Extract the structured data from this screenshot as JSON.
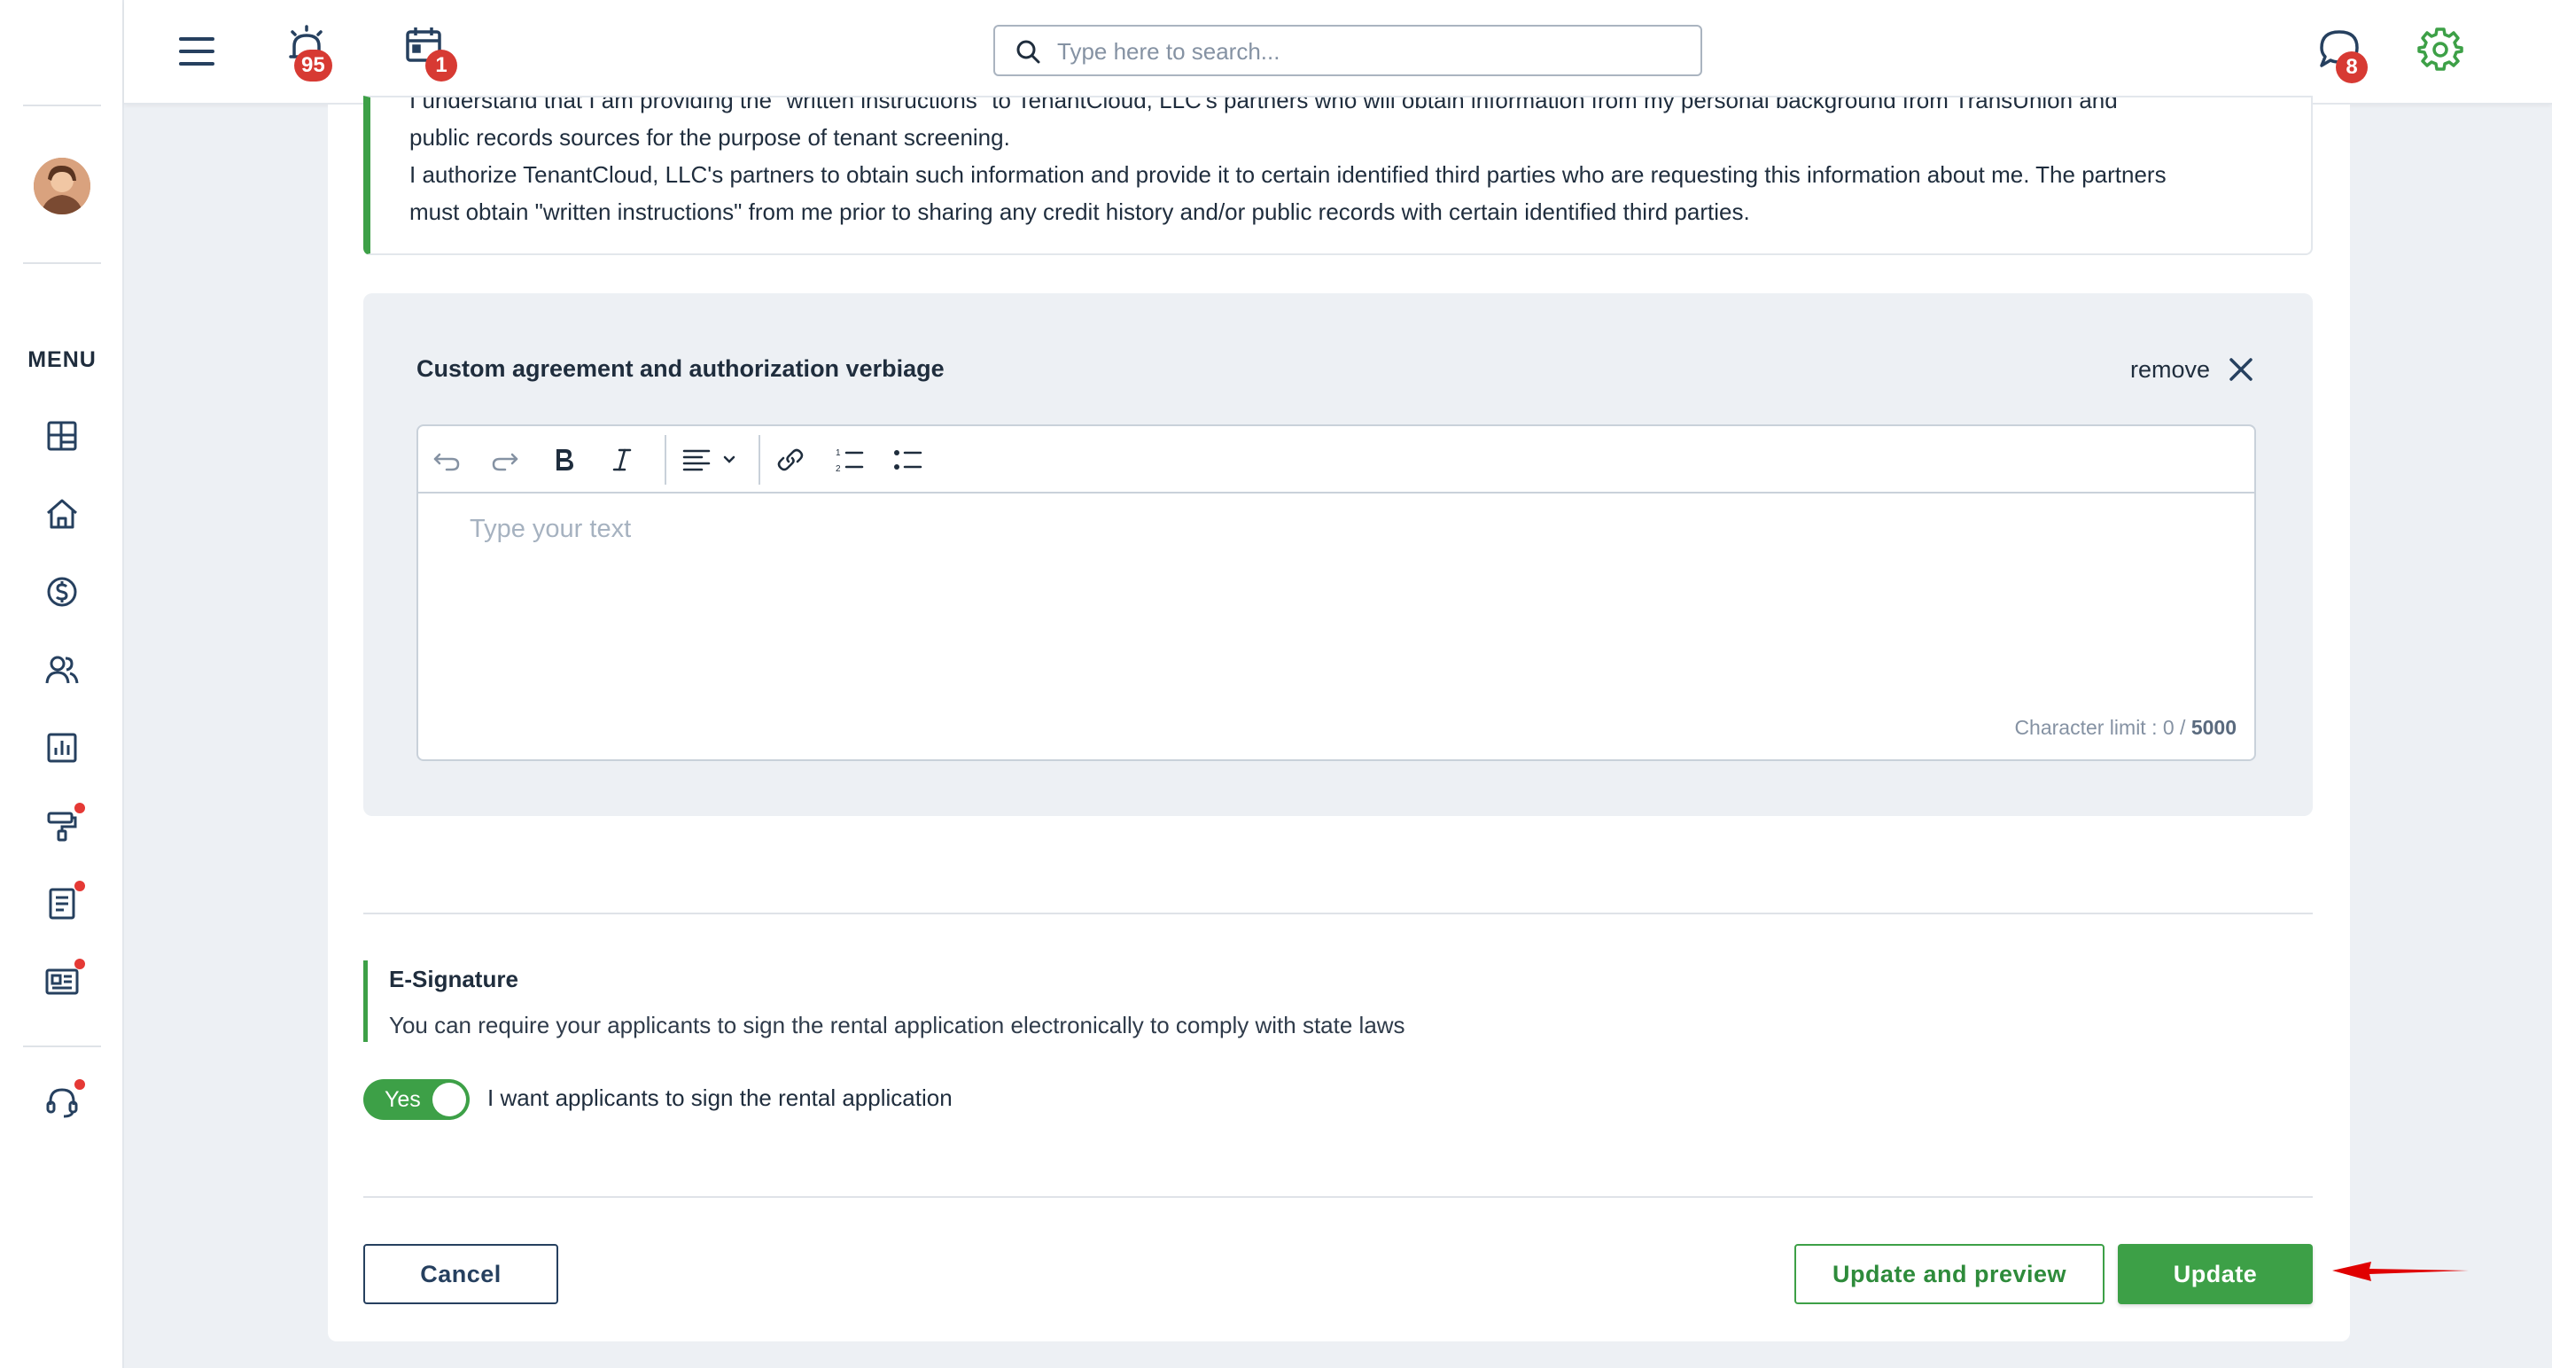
{
  "topbar": {
    "alerts_badge": "95",
    "calendar_badge": "1",
    "messages_badge": "8",
    "search_placeholder": "Type here to search..."
  },
  "sidebar": {
    "menu_label": "MENU",
    "items": [
      {
        "icon": "dashboard-icon",
        "dot": false
      },
      {
        "icon": "home-icon",
        "dot": false
      },
      {
        "icon": "dollar-icon",
        "dot": false
      },
      {
        "icon": "people-icon",
        "dot": false
      },
      {
        "icon": "reports-icon",
        "dot": false
      },
      {
        "icon": "maintenance-icon",
        "dot": true
      },
      {
        "icon": "document-icon",
        "dot": true
      },
      {
        "icon": "listing-icon",
        "dot": true
      },
      {
        "icon": "support-icon",
        "dot": true
      }
    ]
  },
  "notice": {
    "line1": "I understand that I am providing the \"written instructions\" to TenantCloud, LLC's partners who will obtain information from my personal background from TransUnion and",
    "line2": "public records sources for the purpose of tenant screening.",
    "line3": "I authorize TenantCloud, LLC's partners to obtain such information and provide it to certain identified third parties who are requesting this information about me. The partners",
    "line4": "must obtain \"written instructions\" from me prior to sharing any credit history and/or public records with certain identified third parties."
  },
  "custom": {
    "title": "Custom agreement and authorization verbiage",
    "remove_label": "remove",
    "editor_placeholder": "Type your text",
    "char_limit_prefix": "Character limit : 0 / ",
    "char_limit_max": "5000"
  },
  "esignature": {
    "title": "E-Signature",
    "description": "You can require your applicants to sign the rental application electronically to comply with state laws",
    "toggle_state": "Yes",
    "toggle_label": "I want applicants to sign the rental application"
  },
  "actions": {
    "cancel": "Cancel",
    "update_preview": "Update and preview",
    "update": "Update"
  },
  "colors": {
    "accent_green": "#3da047",
    "badge_red": "#d73a33",
    "navy": "#26405f",
    "annotation_arrow": "#e00000"
  }
}
